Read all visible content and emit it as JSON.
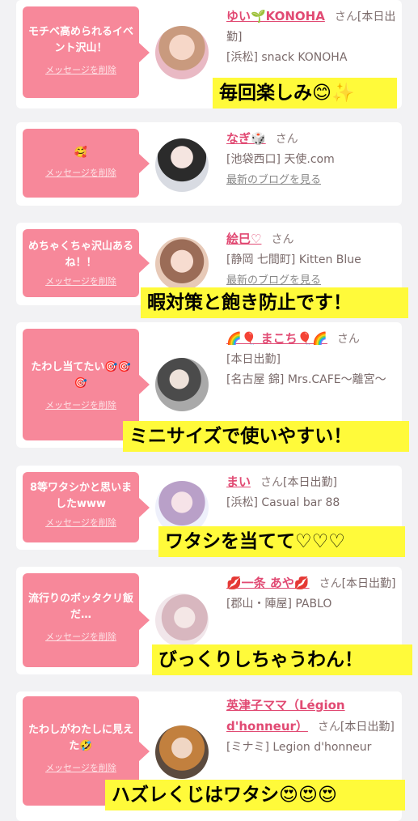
{
  "items": [
    {
      "message": "モチベ高められるイベント沢山！",
      "delete": "メッセージを削除",
      "name": "ゆい🌱KONOHA",
      "honorific": "さん",
      "status": "[本日出勤]",
      "shop": "[浜松] snack KONOHA",
      "blog": ""
    },
    {
      "message": "🥰",
      "delete": "メッセージを削除",
      "name": "なぎ🎲",
      "honorific": "さん",
      "status": "",
      "shop": "[池袋西口] 天使.com",
      "blog": "最新のブログを見る"
    },
    {
      "message": "めちゃくちゃ沢山あるね！！",
      "delete": "メッセージを削除",
      "name": "絵巳♡",
      "honorific": "さん",
      "status": "",
      "shop": "[静岡 七間町] Kitten Blue",
      "blog": "最新のブログを見る"
    },
    {
      "message": "たわし当てたい🎯🎯🎯",
      "delete": "メッセージを削除",
      "name": "🌈🎈 まこち🎈🌈",
      "honorific": "さん",
      "status": "[本日出勤]",
      "shop": "[名古屋 錦] Mrs.CAFE〜離宮〜",
      "blog": ""
    },
    {
      "message": "8等ワタシかと思いましたwww",
      "delete": "メッセージを削除",
      "name": "まい",
      "honorific": "さん",
      "status": "[本日出勤]",
      "shop": "[浜松] Casual bar 88",
      "blog": ""
    },
    {
      "message": "流行りのボッタクリ飯だ…",
      "delete": "メッセージを削除",
      "name": "💋一条 あや💋",
      "honorific": "さん",
      "status": "[本日出勤]",
      "shop": "[郡山・陣屋] PABLO",
      "blog": ""
    },
    {
      "message": "たわしがわたしに見えた🤣",
      "delete": "メッセージを削除",
      "name": "英津子ママ（Légion d'honneur）",
      "honorific": "さん",
      "status": "[本日出勤]",
      "shop": "[ミナミ] Legion d'honneur",
      "blog": ""
    }
  ],
  "overlays": [
    "毎回楽しみ😊✨",
    "暇対策と飽き防止です！",
    "ミニサイズで使いやすい！",
    "ワタシを当てて♡♡♡",
    "びっくりしちゃうわん！",
    "ハズレくじはワタシ😍😍😍"
  ]
}
